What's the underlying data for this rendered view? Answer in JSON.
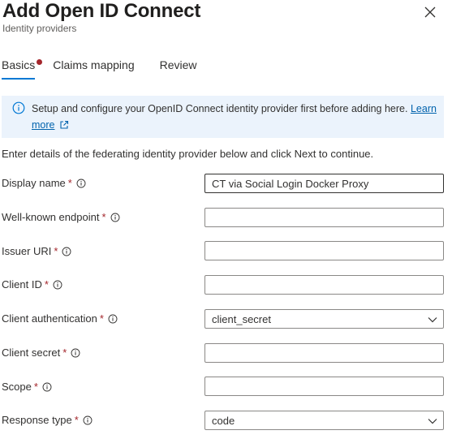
{
  "header": {
    "title": "Add Open ID Connect",
    "subtitle": "Identity providers"
  },
  "tabs": [
    {
      "label": "Basics",
      "active": true,
      "has_error_dot": true
    },
    {
      "label": "Claims mapping",
      "active": false
    },
    {
      "label": "Review",
      "active": false
    }
  ],
  "info_bar": {
    "text": "Setup and configure your OpenID Connect identity provider first before adding here.",
    "link_label_1": "Learn",
    "link_label_2": "more"
  },
  "intro": "Enter details of the federating identity provider below and click Next to continue.",
  "required_mark": "*",
  "fields": {
    "display_name": {
      "label": "Display name",
      "value": "CT via Social Login Docker Proxy"
    },
    "well_known": {
      "label": "Well-known endpoint",
      "value": ""
    },
    "issuer_uri": {
      "label": "Issuer URI",
      "value": ""
    },
    "client_id": {
      "label": "Client ID",
      "value": ""
    },
    "client_auth": {
      "label": "Client authentication",
      "value": "client_secret"
    },
    "client_secret": {
      "label": "Client secret",
      "value": ""
    },
    "scope": {
      "label": "Scope",
      "value": ""
    },
    "response_type": {
      "label": "Response type",
      "value": "code"
    }
  },
  "colors": {
    "accent": "#0078d4",
    "required": "#a4262c",
    "info_bg": "#ebf3fc",
    "link": "#0062ad"
  }
}
